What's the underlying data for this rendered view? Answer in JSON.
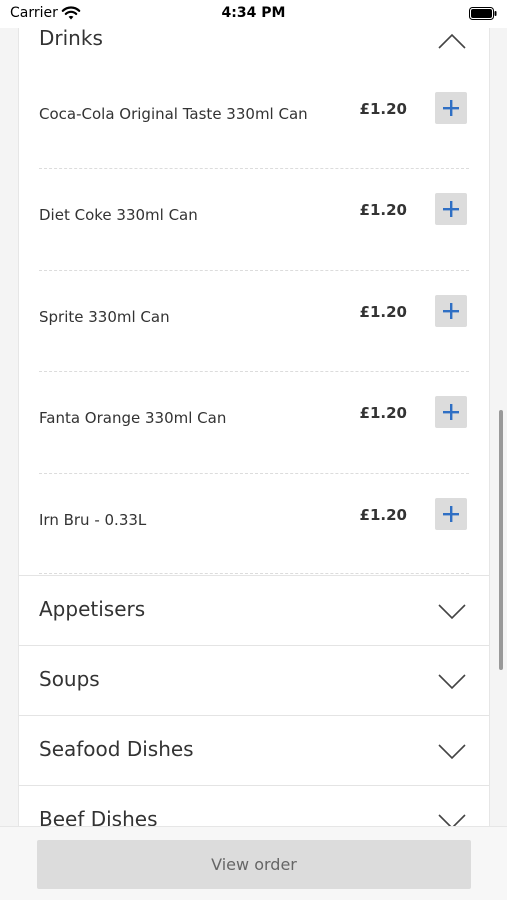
{
  "status_bar": {
    "carrier": "Carrier",
    "time": "4:34 PM"
  },
  "menu": {
    "expanded_section": {
      "title": "Drinks",
      "items": [
        {
          "name": "Coca-Cola Original Taste 330ml Can",
          "price": "£1.20"
        },
        {
          "name": "Diet Coke 330ml Can",
          "price": "£1.20"
        },
        {
          "name": "Sprite 330ml Can",
          "price": "£1.20"
        },
        {
          "name": "Fanta Orange 330ml Can",
          "price": "£1.20"
        },
        {
          "name": "Irn Bru - 0.33L",
          "price": "£1.20"
        }
      ]
    },
    "collapsed_sections": [
      {
        "title": "Appetisers"
      },
      {
        "title": "Soups"
      },
      {
        "title": "Seafood Dishes"
      },
      {
        "title": "Beef Dishes"
      }
    ]
  },
  "footer": {
    "view_order_label": "View order"
  },
  "colors": {
    "accent": "#2f6fc4",
    "button_bg": "#dcdcdc",
    "text": "#333333"
  },
  "icons": {
    "expand": "chevron-down-icon",
    "collapse": "chevron-up-icon",
    "add": "plus-icon"
  }
}
